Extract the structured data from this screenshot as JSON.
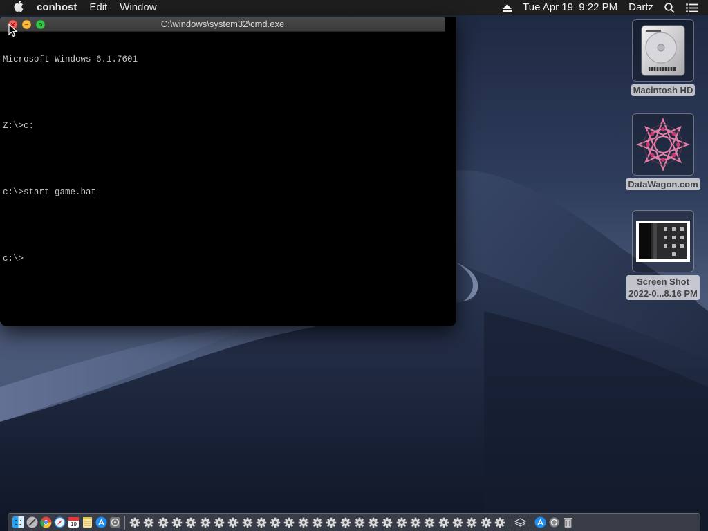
{
  "menubar": {
    "apple_icon": "apple-icon",
    "app_name": "conhost",
    "menus": [
      "Edit",
      "Window"
    ],
    "clock": "Tue Apr 19  9:22 PM",
    "user": "Dartz",
    "status_icons": [
      "eject-icon",
      "spotlight-search-icon",
      "notification-center-icon"
    ]
  },
  "terminal": {
    "title": "C:\\windows\\system32\\cmd.exe",
    "lines": [
      "Microsoft Windows 6.1.7601",
      "",
      "Z:\\>c:",
      "",
      "c:\\>start game.bat",
      "",
      "c:\\>"
    ]
  },
  "desktop_icons": {
    "hd": {
      "label": "Macintosh HD",
      "icon": "hard-drive-icon"
    },
    "datawagon": {
      "label": "DataWagon.com",
      "icon": "datawagon-logo-icon"
    },
    "screenshot": {
      "label_line1": "Screen Shot",
      "label_line2": "2022-0...8.16 PM",
      "icon": "screenshot-thumbnail-icon"
    }
  },
  "dock": {
    "apps": [
      "finder-icon",
      "launchpad-icon",
      "chrome-icon",
      "safari-icon",
      "calendar-icon",
      "notes-icon",
      "app-store-icon",
      "system-preferences-icon"
    ],
    "wine_process_count": 27,
    "right_items": [
      "layers-icon",
      "app-store-icon",
      "settings-icon",
      "trash-icon"
    ]
  },
  "colors": {
    "menubar_bg": "#1e1e1f",
    "console_text": "#c8c8c8",
    "close_button": "#fc605c",
    "minimize_button": "#fdbc40",
    "maximize_button": "#34c84a"
  }
}
